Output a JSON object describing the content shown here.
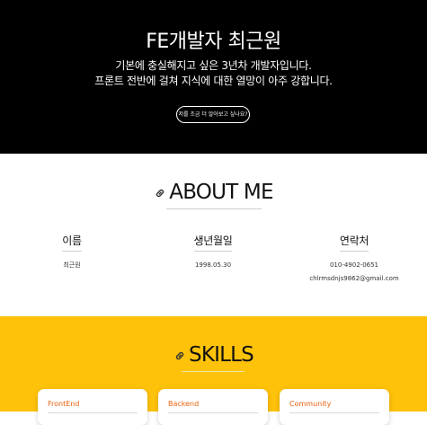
{
  "hero": {
    "title": "FE개발자 최근원",
    "line1": "기본에 충실해지고 싶은 3년차 개발자입니다.",
    "line2": "프론트 전반에 걸쳐 지식에 대한 열망이 아주 강합니다.",
    "button_label": "저를 조금 더 알아보고 싶나요?",
    "background": "#000000"
  },
  "about": {
    "title": "ABOUT ME",
    "icon": "link-icon",
    "items": [
      {
        "label": "이름",
        "value": "최근원"
      },
      {
        "label": "생년월일",
        "value": "1998.05.30"
      },
      {
        "label": "연락처",
        "value": "010-4902-0651",
        "value2": "chlrmsdnjs9862@gmail.com"
      }
    ]
  },
  "skills": {
    "title": "SKILLS",
    "icon": "link-icon",
    "background": "#ffc20a",
    "cards": [
      {
        "title": "FrontEnd"
      },
      {
        "title": "Backend"
      },
      {
        "title": "Community"
      }
    ]
  }
}
